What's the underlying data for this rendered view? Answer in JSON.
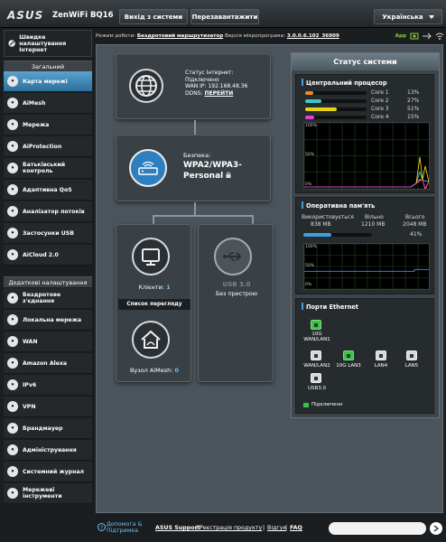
{
  "header": {
    "logo": "ASUS",
    "model": "ZenWiFi BQ16",
    "logout_label": "Вихід з системи",
    "reboot_label": "Перезавантажити",
    "language": "Українська"
  },
  "status_line": {
    "mode_label": "Режим роботи:",
    "mode_value": "Бездротовий маршрутизатор",
    "firmware_label": "Версія мікропрограми:",
    "firmware_value": "3.0.0.6.102_36909",
    "app_label": "App"
  },
  "sidebar": {
    "quick_setup": "Швидке налаштування Інтернет",
    "general_header": "Загальний",
    "general_items": [
      {
        "label": "Карта мережі",
        "icon": "network-map-icon",
        "active": true
      },
      {
        "label": "AiMesh",
        "icon": "aimesh-icon"
      },
      {
        "label": "Мережа",
        "icon": "network-icon"
      },
      {
        "label": "AiProtection",
        "icon": "aiprotection-icon"
      },
      {
        "label": "Батьківський контроль",
        "icon": "parental-control-icon"
      },
      {
        "label": "Адаптивна QoS",
        "icon": "qos-icon"
      },
      {
        "label": "Аналізатор потоків",
        "icon": "traffic-analyzer-icon"
      },
      {
        "label": "Застосунки USB",
        "icon": "usb-icon"
      },
      {
        "label": "AiCloud 2.0",
        "icon": "cloud-icon"
      }
    ],
    "advanced_header": "Додаткові налаштування",
    "advanced_items": [
      {
        "label": "Бездротове з'єднання",
        "icon": "wireless-icon"
      },
      {
        "label": "Локальна мережа",
        "icon": "lan-icon"
      },
      {
        "label": "WAN",
        "icon": "wan-icon"
      },
      {
        "label": "Amazon Alexa",
        "icon": "alexa-icon"
      },
      {
        "label": "IPv6",
        "icon": "ipv6-icon"
      },
      {
        "label": "VPN",
        "icon": "vpn-icon"
      },
      {
        "label": "Брандмауер",
        "icon": "firewall-icon"
      },
      {
        "label": "Адміністрування",
        "icon": "admin-icon"
      },
      {
        "label": "Системний журнал",
        "icon": "syslog-icon"
      },
      {
        "label": "Мережеві інструменти",
        "icon": "network-tools-icon"
      }
    ]
  },
  "map": {
    "internet_status_label": "Статус Інтернет:",
    "internet_status": "Підключено",
    "wan_ip_label": "WAN IP:",
    "wan_ip": "192.168.48.36",
    "ddns_label": "DDNS:",
    "ddns_link": "ПЕРЕЙТИ",
    "security_label": "Безпека:",
    "security_value": "WPA2/WPA3-Personal",
    "clients_label": "Клієнти:",
    "clients_count": "1",
    "view_list": "Список перегляду",
    "usb_title": "USB 3.0",
    "usb_status": "Без пристрою",
    "aimesh_label": "Вузол AiMesh:",
    "aimesh_count": "0"
  },
  "status": {
    "title": "Статус системи",
    "cpu_title": "Центральний процесор",
    "cores": [
      {
        "label": "Core 1",
        "pct": "13%",
        "value": 13,
        "color": "#f08a1d"
      },
      {
        "label": "Core 2",
        "pct": "27%",
        "value": 27,
        "color": "#3ec7c7"
      },
      {
        "label": "Core 3",
        "pct": "51%",
        "value": 51,
        "color": "#e6d21a"
      },
      {
        "label": "Core 4",
        "pct": "15%",
        "value": 15,
        "color": "#e040d8"
      }
    ],
    "graph_top": "100%",
    "graph_mid": "50%",
    "graph_bottom": "0%",
    "ram_title": "Оперативна пам'ять",
    "ram_used_label": "Використовується",
    "ram_used": "838 MB",
    "ram_free_label": "Вільно",
    "ram_free": "1210 MB",
    "ram_total_label": "Всього",
    "ram_total": "2048 MB",
    "ram_pct": "41%",
    "ram_value": 41,
    "ports_title": "Порти Ethernet",
    "port_wan": "10G WAN/LAN1",
    "port_lan2": "WAN/LAN2",
    "port_lan3": "10G LAN3",
    "port_lan4": "LAN4",
    "port_lan5": "LAN5",
    "port_usb": "USB3.0",
    "legend_connected": "Підключено"
  },
  "footer": {
    "help": "Допомога & Підтримка",
    "asus_support": "ASUS Support",
    "register": "Реєстрація продукту",
    "feedback": "Відгук",
    "faq": "FAQ"
  }
}
